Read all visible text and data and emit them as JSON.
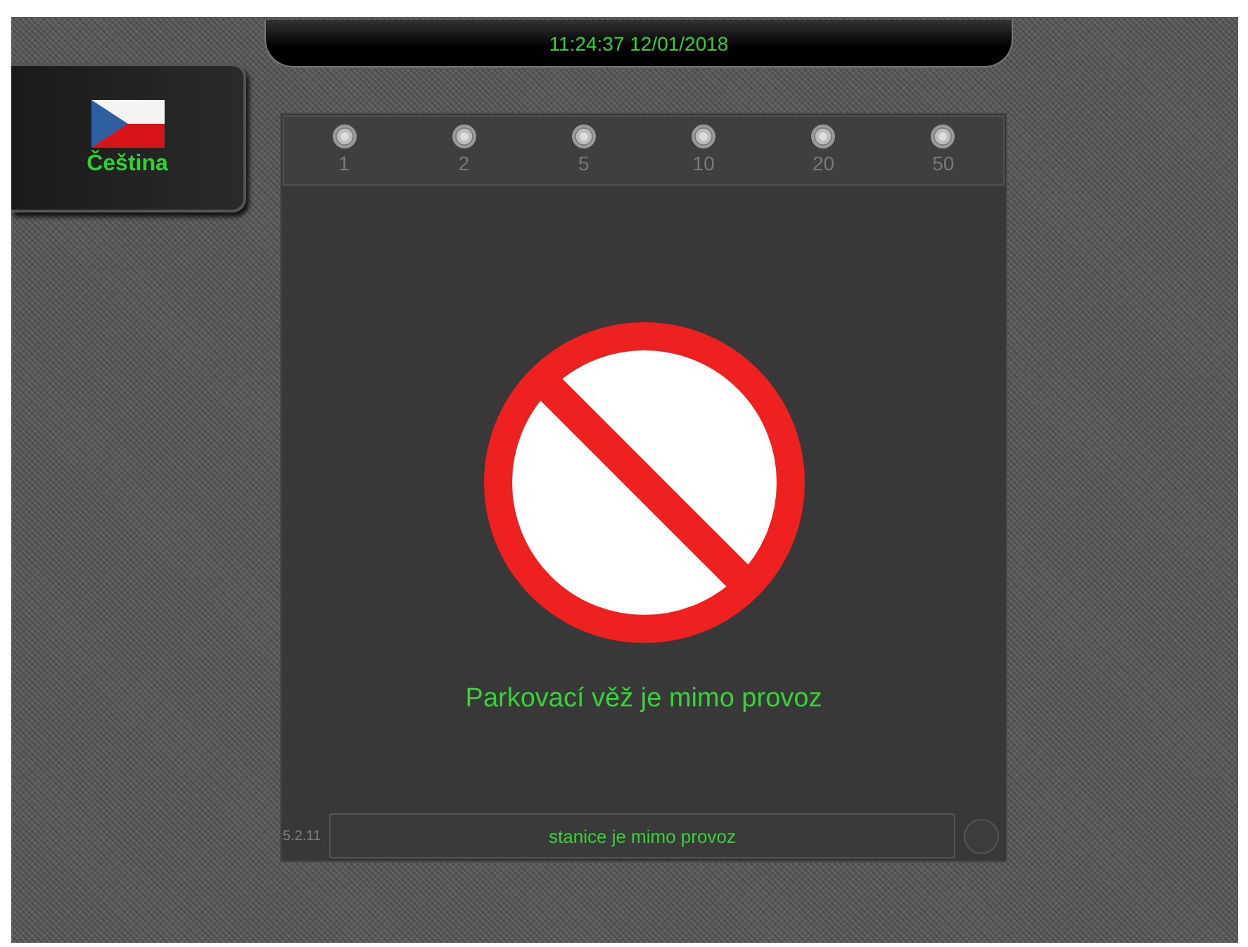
{
  "clock": {
    "time": "11:24:37 12/01/2018"
  },
  "language_button": {
    "label": "Čeština"
  },
  "coins": [
    {
      "label": "1",
      "disabled": true
    },
    {
      "label": "2",
      "disabled": true
    },
    {
      "label": "5",
      "disabled": true
    },
    {
      "label": "10",
      "disabled": true
    },
    {
      "label": "20",
      "disabled": true
    },
    {
      "label": "50",
      "disabled": true
    }
  ],
  "message": "Parkovací věž je mimo provoz",
  "version": "5.2.11",
  "status": "stanice je mimo provoz"
}
